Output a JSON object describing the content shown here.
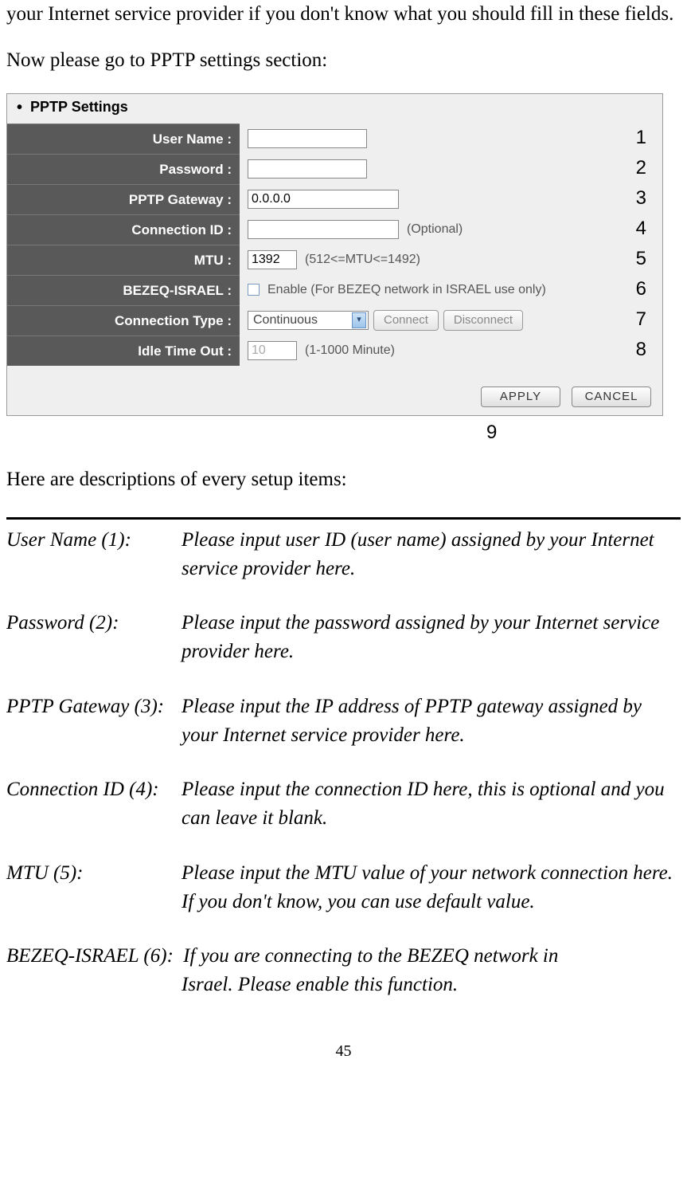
{
  "intro": {
    "line1": "your Internet service provider if you don't know what you should fill in these fields.",
    "line2": "Now please go to PPTP settings section:"
  },
  "panel": {
    "title": "PPTP Settings",
    "rows": {
      "user_name": {
        "label": "User Name :",
        "value": ""
      },
      "password": {
        "label": "Password :",
        "value": ""
      },
      "pptp_gateway": {
        "label": "PPTP Gateway :",
        "value": "0.0.0.0"
      },
      "connection_id": {
        "label": "Connection ID :",
        "value": "",
        "hint": "(Optional)"
      },
      "mtu": {
        "label": "MTU :",
        "value": "1392",
        "hint": "(512<=MTU<=1492)"
      },
      "bezeq": {
        "label": "BEZEQ-ISRAEL :",
        "hint": "Enable (For BEZEQ network in ISRAEL use only)"
      },
      "conn_type": {
        "label": "Connection Type :",
        "selected": "Continuous",
        "connect": "Connect",
        "disconnect": "Disconnect"
      },
      "idle": {
        "label": "Idle Time Out :",
        "value": "10",
        "hint": "(1-1000 Minute)"
      }
    },
    "buttons": {
      "apply": "APPLY",
      "cancel": "CANCEL"
    },
    "annotations": {
      "a1": "1",
      "a2": "2",
      "a3": "3",
      "a4": "4",
      "a5": "5",
      "a6": "6",
      "a7": "7",
      "a8": "8",
      "a9": "9"
    }
  },
  "descriptions": {
    "heading": "Here are descriptions of every setup items:",
    "items": [
      {
        "term": "User Name (1):",
        "def": "Please input user ID (user name) assigned by your Internet service provider here."
      },
      {
        "term": "Password (2):",
        "def": "Please input the password assigned by your Internet service provider here."
      },
      {
        "term": "PPTP Gateway (3):",
        "def": "Please input the IP address of PPTP gateway assigned by your Internet service provider here."
      },
      {
        "term": "Connection ID (4):",
        "def": "Please input the connection ID here, this is optional and you can leave it blank."
      },
      {
        "term": "MTU (5):",
        "def": "Please input the MTU value of your network connection here. If you don't know, you can use default value."
      },
      {
        "term": "BEZEQ-ISRAEL (6):",
        "def_first": "If you are connecting to the BEZEQ network in",
        "def_cont": "Israel. Please enable this function."
      }
    ]
  },
  "page_number": "45"
}
